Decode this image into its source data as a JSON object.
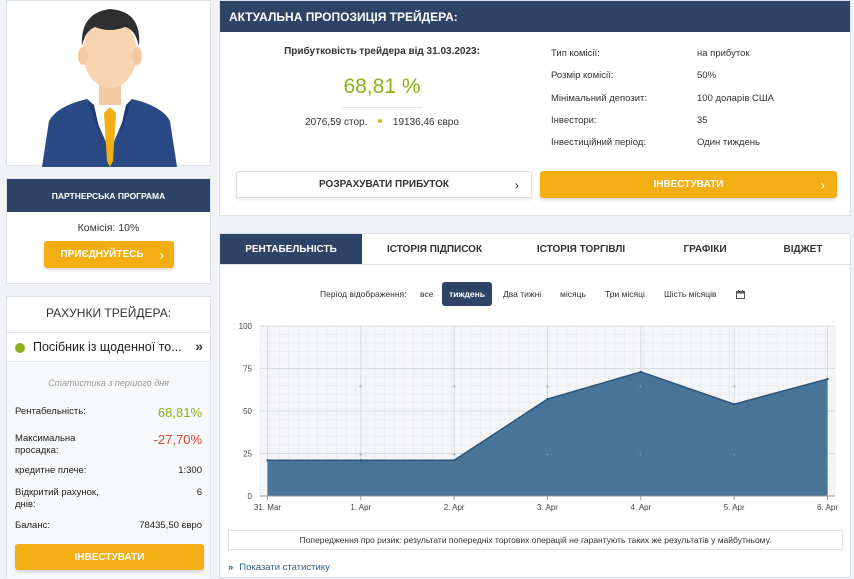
{
  "avatar": {
    "icon": "person-avatar-icon"
  },
  "partner": {
    "header": "ПАРТНЕРСЬКА ПРОГРАМА",
    "commission": "Комісія: 10%",
    "join_label": "ПРИЄДНУЙТЕСЬ",
    "join_icon": "chevron-right-icon"
  },
  "accounts": {
    "title": "РАХУНКИ ТРЕЙДЕРА:",
    "account_name": "Посібник із щоденної то...",
    "status_color": "#8ab31a",
    "since": "Статистика з першого дня",
    "stats": [
      {
        "label": "Рентабельність:",
        "value": "68,81%",
        "color": "#8ab31a"
      },
      {
        "label": "Максимальна просадка:",
        "value": "-27,70%",
        "color": "#d9472b"
      },
      {
        "label": "кредитне плече:",
        "value": "1:300",
        "color": "#222"
      },
      {
        "label": "Відкритий рахунок, днів:",
        "value": "6",
        "color": "#222"
      },
      {
        "label": "Баланс:",
        "value": "78435,50 євро",
        "color": "#222"
      }
    ],
    "invest_label": "ІНВЕСТУВАТИ"
  },
  "offer": {
    "header": "АКТУАЛЬНА ПРОПОЗИЦІЯ ТРЕЙДЕРА:",
    "profit_caption": "Прибутковість трейдера від 31.03.2023:",
    "profit_value": "68,81 %",
    "pips": "2076,59 стор.",
    "money": "19136,46 євро",
    "dot_color": "#f2ae12",
    "details": [
      {
        "label": "Тип комісії:",
        "value": "на прибуток"
      },
      {
        "label": "Розмір комісії:",
        "value": "50%"
      },
      {
        "label": "Мінімальний депозит:",
        "value": "100 доларів США"
      },
      {
        "label": "Інвестори:",
        "value": "35"
      },
      {
        "label": "Інвестиційний період:",
        "value": "Один тиждень"
      }
    ],
    "calc_label": "РОЗРАХУВАТИ ПРИБУТОК",
    "invest_label": "ІНВЕСТУВАТИ"
  },
  "tabs": [
    {
      "label": "РЕНТАБЕЛЬНІСТЬ",
      "active": true
    },
    {
      "label": "ІСТОРІЯ ПІДПИСОК",
      "active": false
    },
    {
      "label": "ІСТОРІЯ ТОРГІВЛІ",
      "active": false
    },
    {
      "label": "ГРАФІКИ",
      "active": false
    },
    {
      "label": "ВІДЖЕТ",
      "active": false
    }
  ],
  "period": {
    "label": "Період відображення:",
    "options": [
      {
        "label": "все",
        "active": false
      },
      {
        "label": "тиждень",
        "active": true
      },
      {
        "label": "Два тижні",
        "active": false
      },
      {
        "label": "місяць",
        "active": false
      },
      {
        "label": "Три місяці",
        "active": false
      },
      {
        "label": "Шість місяців",
        "active": false
      }
    ],
    "calendar_icon": "calendar-icon"
  },
  "chart_data": {
    "type": "area",
    "x": [
      "31. Mar",
      "1. Apr",
      "2. Apr",
      "3. Apr",
      "4. Apr",
      "5. Apr",
      "6. Apr"
    ],
    "points": [
      {
        "x": 0.0,
        "y": 21
      },
      {
        "x": 1.0,
        "y": 21
      },
      {
        "x": 2.0,
        "y": 21
      },
      {
        "x": 3.0,
        "y": 57
      },
      {
        "x": 4.0,
        "y": 73
      },
      {
        "x": 5.0,
        "y": 54
      },
      {
        "x": 6.0,
        "y": 68.8
      }
    ],
    "xlim": [
      -0.08,
      6.08
    ],
    "yticks": [
      0,
      25,
      50,
      75,
      100
    ],
    "ylim": [
      0,
      100
    ],
    "grid": true,
    "fill_color": "#3f6e93",
    "line_color": "#2e5578"
  },
  "risk_warning": "Попередження про ризик: результати попередніх торгових операцій не гарантують таких же результатів у майбутньому.",
  "show_stats": "Показати статистику"
}
